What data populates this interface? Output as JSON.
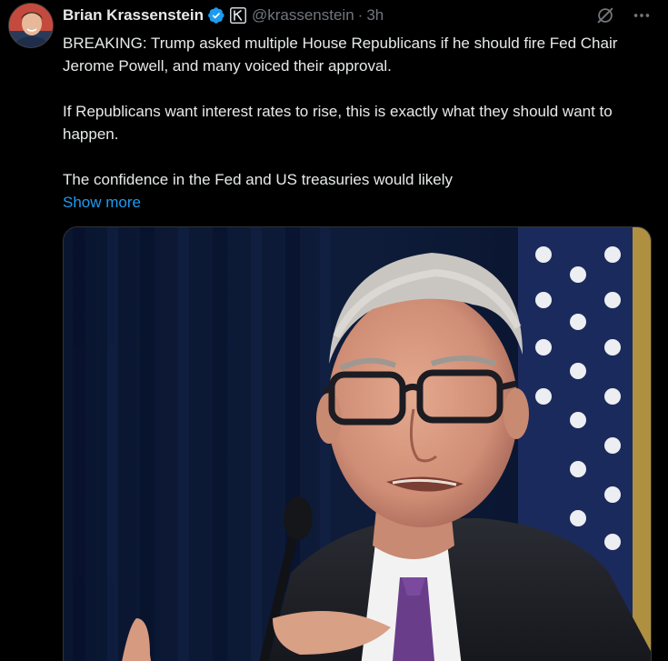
{
  "author": {
    "display_name": "Brian Krassenstein",
    "handle": "@krassenstein",
    "separator": "·",
    "time": "3h",
    "avatar_icon": "avatar-photo",
    "verified_icon": "verified-badge-icon",
    "affiliation_icon": "k-affiliation-icon"
  },
  "actions": {
    "grok_icon": "grok-icon",
    "more_icon": "more-options-icon"
  },
  "post": {
    "paragraphs": [
      "BREAKING:  Trump asked multiple House Republicans if he should fire Fed Chair Jerome Powell, and many voiced their approval.",
      "If Republicans want interest rates to rise, this is exactly what they should want to happen.",
      "The confidence in the Fed and US treasuries would likely"
    ],
    "show_more": "Show more"
  },
  "media": {
    "image_icon": "photo-man-with-microphone"
  },
  "colors": {
    "background": "#000000",
    "text": "#e7e9ea",
    "muted": "#71767b",
    "link": "#1d9bf0",
    "verified": "#1d9bf0"
  }
}
